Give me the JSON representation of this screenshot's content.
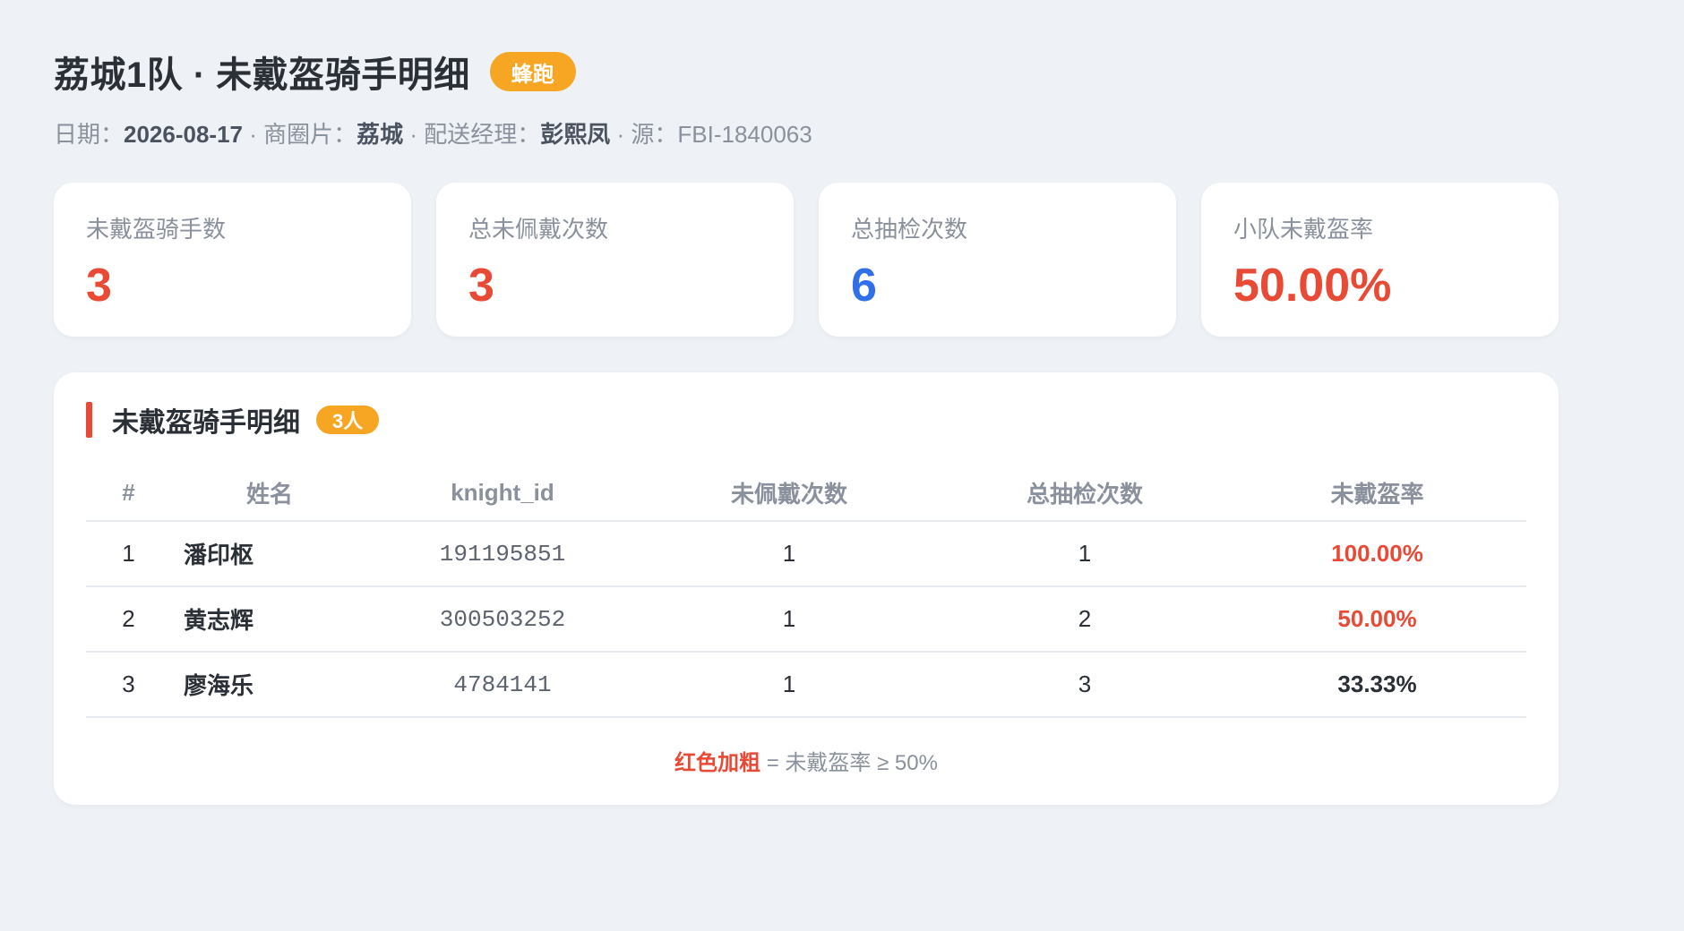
{
  "header": {
    "title": "荔城1队 · 未戴盔骑手明细",
    "brand_badge": "蜂跑",
    "meta": {
      "date_label": "日期：",
      "date": "2026-08-17",
      "sep1": " · ",
      "area_label": "商圈片：",
      "area": "荔城",
      "sep2": " · ",
      "manager_label": "配送经理：",
      "manager": "彭熙凤",
      "sep3": " · ",
      "source": "源：FBI-1840063"
    }
  },
  "colors": {
    "accent_red": "#e94a35",
    "accent_blue": "#2f6fe8",
    "badge_orange": "#f6a623"
  },
  "kpis": [
    {
      "label": "未戴盔骑手数",
      "value": "3",
      "color": "#e94a35"
    },
    {
      "label": "总未佩戴次数",
      "value": "3",
      "color": "#e94a35"
    },
    {
      "label": "总抽检次数",
      "value": "6",
      "color": "#2f6fe8"
    },
    {
      "label": "小队未戴盔率",
      "value": "50.00%",
      "color": "#e94a35"
    }
  ],
  "panel": {
    "title": "未戴盔骑手明细",
    "count_badge": "3人",
    "columns": [
      "#",
      "姓名",
      "knight_id",
      "未佩戴次数",
      "总抽检次数",
      "未戴盔率"
    ],
    "rows": [
      {
        "idx": "1",
        "name": "潘印枢",
        "knight_id": "191195851",
        "missed": "1",
        "total": "1",
        "rate": "100.00%",
        "high": true
      },
      {
        "idx": "2",
        "name": "黄志辉",
        "knight_id": "300503252",
        "missed": "1",
        "total": "2",
        "rate": "50.00%",
        "high": true
      },
      {
        "idx": "3",
        "name": "廖海乐",
        "knight_id": "4784141",
        "missed": "1",
        "total": "3",
        "rate": "33.33%",
        "high": false
      }
    ],
    "footnote_red": "红色加粗",
    "footnote_rest": " = 未戴盔率 ≥ 50%"
  }
}
